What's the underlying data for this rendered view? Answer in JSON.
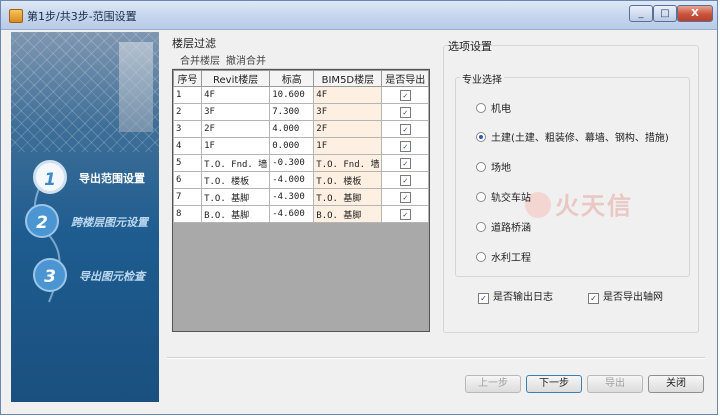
{
  "window": {
    "title": "第1步/共3步-范围设置"
  },
  "sidebar": {
    "steps": [
      {
        "num": "1",
        "label": "导出范围设置"
      },
      {
        "num": "2",
        "label": "跨楼层图元设置"
      },
      {
        "num": "3",
        "label": "导出图元检查"
      }
    ]
  },
  "floor": {
    "group_label": "楼层过滤",
    "merge_label": "合并楼层",
    "unmerge_label": "撤消合并",
    "columns": [
      "序号",
      "Revit楼层",
      "标高",
      "BIM5D楼层",
      "是否导出"
    ],
    "rows": [
      {
        "no": "1",
        "revit": "4F",
        "elev": "10.600",
        "bim": "4F",
        "export": true
      },
      {
        "no": "2",
        "revit": "3F",
        "elev": "7.300",
        "bim": "3F",
        "export": true
      },
      {
        "no": "3",
        "revit": "2F",
        "elev": "4.000",
        "bim": "2F",
        "export": true
      },
      {
        "no": "4",
        "revit": "1F",
        "elev": "0.000",
        "bim": "1F",
        "export": true
      },
      {
        "no": "5",
        "revit": "T.O. Fnd. 墙",
        "elev": "-0.300",
        "bim": "T.O. Fnd. 墙",
        "export": true
      },
      {
        "no": "6",
        "revit": "T.O. 楼板",
        "elev": "-4.000",
        "bim": "T.O. 楼板",
        "export": true
      },
      {
        "no": "7",
        "revit": "T.O. 基脚",
        "elev": "-4.300",
        "bim": "T.O. 基脚",
        "export": true
      },
      {
        "no": "8",
        "revit": "B.O. 基脚",
        "elev": "-4.600",
        "bim": "B.O. 基脚",
        "export": true
      }
    ]
  },
  "options": {
    "title": "选项设置",
    "spec_title": "专业选择",
    "radios": [
      {
        "label": "机电",
        "selected": false
      },
      {
        "label": "土建(土建、粗装修、幕墙、钢构、措施)",
        "selected": true
      },
      {
        "label": "场地",
        "selected": false
      },
      {
        "label": "轨交车站",
        "selected": false
      },
      {
        "label": "道路桥涵",
        "selected": false
      },
      {
        "label": "水利工程",
        "selected": false
      }
    ],
    "log_label": "是否输出日志",
    "grid_label": "是否导出轴网"
  },
  "watermark": {
    "text": "火天信"
  },
  "buttons": {
    "prev": "上一步",
    "next": "下一步",
    "export": "导出",
    "close": "关闭"
  },
  "check_glyph": "✓"
}
